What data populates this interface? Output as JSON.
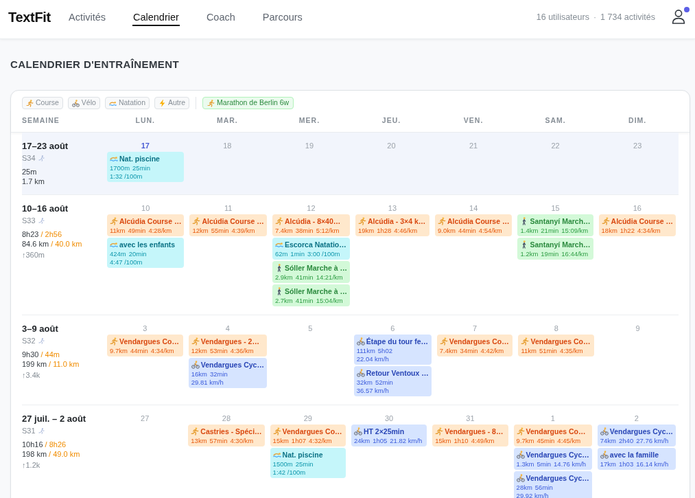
{
  "header": {
    "logo": "TextFit",
    "tabs": [
      {
        "label": "Activités",
        "selected": false
      },
      {
        "label": "Calendrier",
        "selected": true
      },
      {
        "label": "Coach",
        "selected": false
      },
      {
        "label": "Parcours",
        "selected": false
      }
    ],
    "stats": {
      "users": "16 utilisateurs",
      "separator": "·",
      "activities": "1 734 activités"
    },
    "user": {
      "notification": true
    }
  },
  "page": {
    "title": "CALENDRIER D'ENTRAÎNEMENT"
  },
  "legend": {
    "sports": [
      {
        "kind": "run",
        "label": "Course"
      },
      {
        "kind": "bike",
        "label": "Vélo"
      },
      {
        "kind": "swim",
        "label": "Natation"
      },
      {
        "kind": "other",
        "label": "Autre"
      }
    ],
    "plan": {
      "kind": "run",
      "label": "Marathon de Berlin 6w"
    }
  },
  "columns": [
    "SEMAINE",
    "LUN.",
    "MAR.",
    "MER.",
    "JEU.",
    "VEN.",
    "SAM.",
    "DIM."
  ],
  "weeks": [
    {
      "range": "17–23 août",
      "label": "S34",
      "current": true,
      "total_time": "25m",
      "total_distance": "1.7 km",
      "days": [
        {
          "date": "17",
          "today": true,
          "activities": [
            {
              "kind": "swim",
              "title": "Nat. piscine",
              "stat_lines": [
                [
                  "1700m",
                  "25min"
                ],
                [
                  "1:32 /100m"
                ]
              ]
            }
          ]
        },
        {
          "date": "18",
          "today": false
        },
        {
          "date": "19",
          "today": false
        },
        {
          "date": "20",
          "today": false
        },
        {
          "date": "21",
          "today": false
        },
        {
          "date": "22",
          "today": false
        },
        {
          "date": "23",
          "today": false
        }
      ]
    },
    {
      "range": "10–16 août",
      "label": "S33",
      "current": false,
      "total_time": "8h23",
      "run_time": "/ 2h56",
      "total_distance": "84.6 km",
      "run_distance": "/ 40.0 km",
      "elevation": "↑360m",
      "days": [
        {
          "date": "10",
          "today": false,
          "activities": [
            {
              "kind": "run",
              "title": "Alcúdia Course …",
              "stat_lines": [
                [
                  "11km",
                  "49min",
                  "4:28/km"
                ]
              ]
            },
            {
              "kind": "swim",
              "title": "avec les enfants",
              "stat_lines": [
                [
                  "424m",
                  "20min"
                ],
                [
                  "4:47 /100m"
                ]
              ]
            }
          ]
        },
        {
          "date": "11",
          "today": false,
          "activities": [
            {
              "kind": "run",
              "title": "Alcúdia Course …",
              "stat_lines": [
                [
                  "12km",
                  "55min",
                  "4:39/km"
                ]
              ]
            }
          ]
        },
        {
          "date": "12",
          "today": false,
          "activities": [
            {
              "kind": "run",
              "title": "Alcúdia - 8×40…",
              "stat_lines": [
                [
                  "7.4km",
                  "38min",
                  "5:12/km"
                ]
              ]
            },
            {
              "kind": "swim",
              "title": "Escorca Natatio…",
              "stat_lines": [
                [
                  "62m",
                  "1min",
                  "3:00 /100m"
                ]
              ]
            },
            {
              "kind": "walk",
              "title": "Sóller Marche à …",
              "stat_lines": [
                [
                  "2.9km",
                  "41min",
                  "14:21/km"
                ]
              ]
            },
            {
              "kind": "walk",
              "title": "Sóller Marche à …",
              "stat_lines": [
                [
                  "2.7km",
                  "41min",
                  "15:04/km"
                ]
              ]
            }
          ]
        },
        {
          "date": "13",
          "today": false,
          "activities": [
            {
              "kind": "run",
              "title": "Alcúdia - 3×4 k…",
              "stat_lines": [
                [
                  "19km",
                  "1h28",
                  "4:46/km"
                ]
              ]
            }
          ]
        },
        {
          "date": "14",
          "today": false,
          "activities": [
            {
              "kind": "run",
              "title": "Alcúdia Course …",
              "stat_lines": [
                [
                  "9.0km",
                  "44min",
                  "4:54/km"
                ]
              ]
            }
          ]
        },
        {
          "date": "15",
          "today": false,
          "activities": [
            {
              "kind": "walk",
              "title": "Santanyí March…",
              "stat_lines": [
                [
                  "1.4km",
                  "21min",
                  "15:09/km"
                ]
              ]
            },
            {
              "kind": "walk",
              "title": "Santanyí March…",
              "stat_lines": [
                [
                  "1.2km",
                  "19min",
                  "16:44/km"
                ]
              ]
            }
          ]
        },
        {
          "date": "16",
          "today": false,
          "activities": [
            {
              "kind": "run",
              "title": "Alcúdia Course …",
              "stat_lines": [
                [
                  "18km",
                  "1h22",
                  "4:34/km"
                ]
              ]
            }
          ]
        }
      ]
    },
    {
      "range": "3–9 août",
      "label": "S32",
      "current": false,
      "total_time": "9h30",
      "run_time": "/ 44m",
      "total_distance": "199 km",
      "run_distance": "/ 11.0 km",
      "elevation": "↑3.4k",
      "days": [
        {
          "date": "3",
          "today": false,
          "activities": [
            {
              "kind": "run",
              "title": "Vendargues Co…",
              "stat_lines": [
                [
                  "9.7km",
                  "44min",
                  "4:34/km"
                ]
              ]
            }
          ]
        },
        {
          "date": "4",
          "today": false,
          "activities": [
            {
              "kind": "run",
              "title": "Vendargues - 2…",
              "stat_lines": [
                [
                  "12km",
                  "53min",
                  "4:36/km"
                ]
              ]
            },
            {
              "kind": "bike",
              "title": "Vendargues Cyc…",
              "stat_lines": [
                [
                  "16km",
                  "32min"
                ],
                [
                  "29.81 km/h"
                ]
              ]
            }
          ]
        },
        {
          "date": "5",
          "today": false
        },
        {
          "date": "6",
          "today": false,
          "activities": [
            {
              "kind": "bike",
              "title": "Étape du tour fe…",
              "stat_lines": [
                [
                  "111km",
                  "5h02"
                ],
                [
                  "22.04 km/h"
                ]
              ]
            },
            {
              "kind": "bike",
              "title": "Retour Ventoux …",
              "stat_lines": [
                [
                  "32km",
                  "52min"
                ],
                [
                  "36.57 km/h"
                ]
              ]
            }
          ]
        },
        {
          "date": "7",
          "today": false,
          "activities": [
            {
              "kind": "run",
              "title": "Vendargues Co…",
              "stat_lines": [
                [
                  "7.4km",
                  "34min",
                  "4:42/km"
                ]
              ]
            }
          ]
        },
        {
          "date": "8",
          "today": false,
          "activities": [
            {
              "kind": "run",
              "title": "Vendargues Co…",
              "stat_lines": [
                [
                  "11km",
                  "51min",
                  "4:35/km"
                ]
              ]
            }
          ]
        },
        {
          "date": "9",
          "today": false
        }
      ]
    },
    {
      "range": "27 juil. – 2 août",
      "label": "S31",
      "current": false,
      "total_time": "10h16",
      "run_time": "/ 8h26",
      "total_distance": "198 km",
      "run_distance": "/ 49.0 km",
      "elevation": "↑1.2k",
      "days": [
        {
          "date": "27",
          "today": false
        },
        {
          "date": "28",
          "today": false,
          "activities": [
            {
              "kind": "run",
              "title": "Castries - Spéci…",
              "stat_lines": [
                [
                  "13km",
                  "57min",
                  "4:30/km"
                ]
              ]
            }
          ]
        },
        {
          "date": "29",
          "today": false,
          "activities": [
            {
              "kind": "run",
              "title": "Vendargues Co…",
              "stat_lines": [
                [
                  "15km",
                  "1h07",
                  "4:32/km"
                ]
              ]
            },
            {
              "kind": "swim",
              "title": "Nat. piscine",
              "stat_lines": [
                [
                  "1500m",
                  "25min"
                ],
                [
                  "1:42 /100m"
                ]
              ]
            }
          ]
        },
        {
          "date": "30",
          "today": false,
          "activities": [
            {
              "kind": "bike",
              "title": "HT 2×25min",
              "stat_lines": [
                [
                  "24km",
                  "1h05",
                  "21.82 km/h"
                ]
              ]
            }
          ]
        },
        {
          "date": "31",
          "today": false,
          "activities": [
            {
              "kind": "run",
              "title": "Vendargues - 8…",
              "stat_lines": [
                [
                  "15km",
                  "1h10",
                  "4:49/km"
                ]
              ]
            }
          ]
        },
        {
          "date": "1",
          "today": false,
          "activities": [
            {
              "kind": "run",
              "title": "Vendargues Co…",
              "stat_lines": [
                [
                  "9.7km",
                  "45min",
                  "4:45/km"
                ]
              ]
            },
            {
              "kind": "bike",
              "title": "Vendargues Cyc…",
              "stat_lines": [
                [
                  "1.3km",
                  "5min",
                  "14.76 km/h"
                ]
              ]
            },
            {
              "kind": "bike",
              "title": "Vendargues Cyc…",
              "stat_lines": [
                [
                  "28km",
                  "56min"
                ],
                [
                  "29.92 km/h"
                ]
              ]
            }
          ]
        },
        {
          "date": "2",
          "today": false,
          "activities": [
            {
              "kind": "bike",
              "title": "Vendargues Cyc…",
              "stat_lines": [
                [
                  "74km",
                  "2h40",
                  "27.76 km/h"
                ]
              ]
            },
            {
              "kind": "bike",
              "title": "avec la famille",
              "stat_lines": [
                [
                  "17km",
                  "1h03",
                  "16.14 km/h"
                ]
              ]
            }
          ]
        }
      ]
    }
  ]
}
